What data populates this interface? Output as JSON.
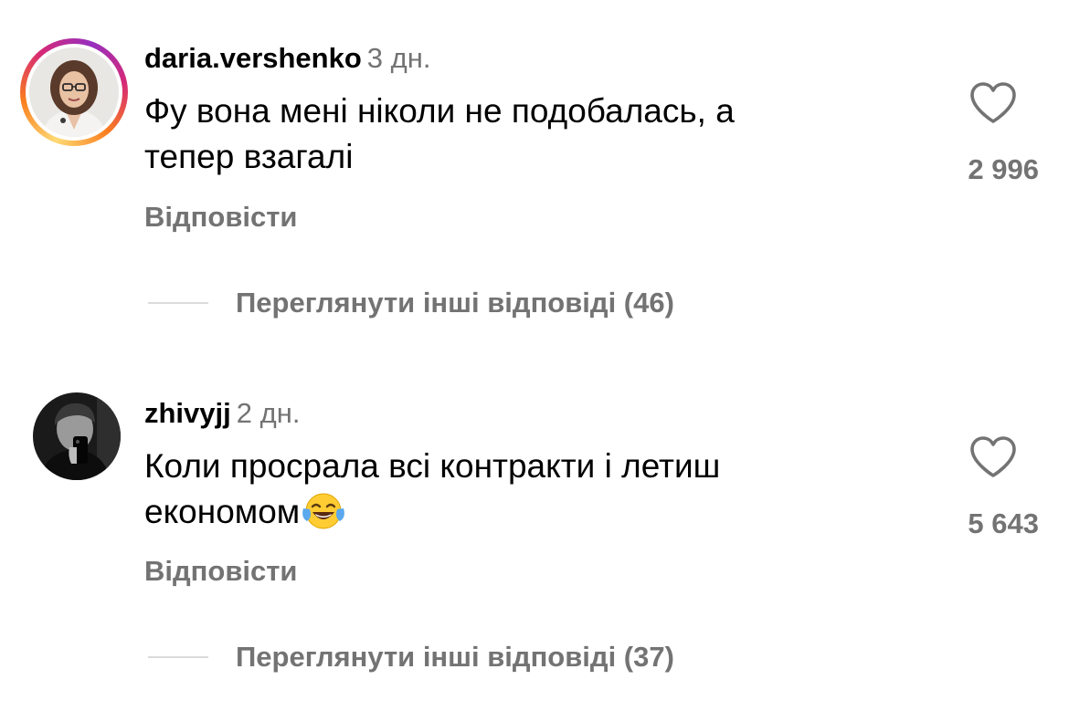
{
  "comments": [
    {
      "username": "daria.vershenko",
      "time": "3 дн.",
      "text_line1": "Фу вона мені ніколи не подобалась, а",
      "text_line2": "тепер взагалі",
      "likes": "2 996",
      "reply_label": "Відповісти",
      "view_replies_label": "Переглянути інші відповіді (46)",
      "has_story_ring": true,
      "avatar_icon": "woman-with-glasses-avatar-icon"
    },
    {
      "username": "zhivyjj",
      "time": "2 дн.",
      "text_line1": "Коли просрала всі контракти і летиш",
      "text_line2": "економом",
      "emoji": "😂",
      "emoji_icon": "face-with-tears-of-joy-icon",
      "likes": "5 643",
      "reply_label": "Відповісти",
      "view_replies_label": "Переглянути інші відповіді (37)",
      "has_story_ring": false,
      "avatar_icon": "man-mirror-selfie-avatar-icon"
    }
  ],
  "colors": {
    "secondary_text": "#737373",
    "divider": "#dbdbdb",
    "heart_stroke": "#737373"
  },
  "icons": {
    "like": "heart-outline-icon"
  }
}
